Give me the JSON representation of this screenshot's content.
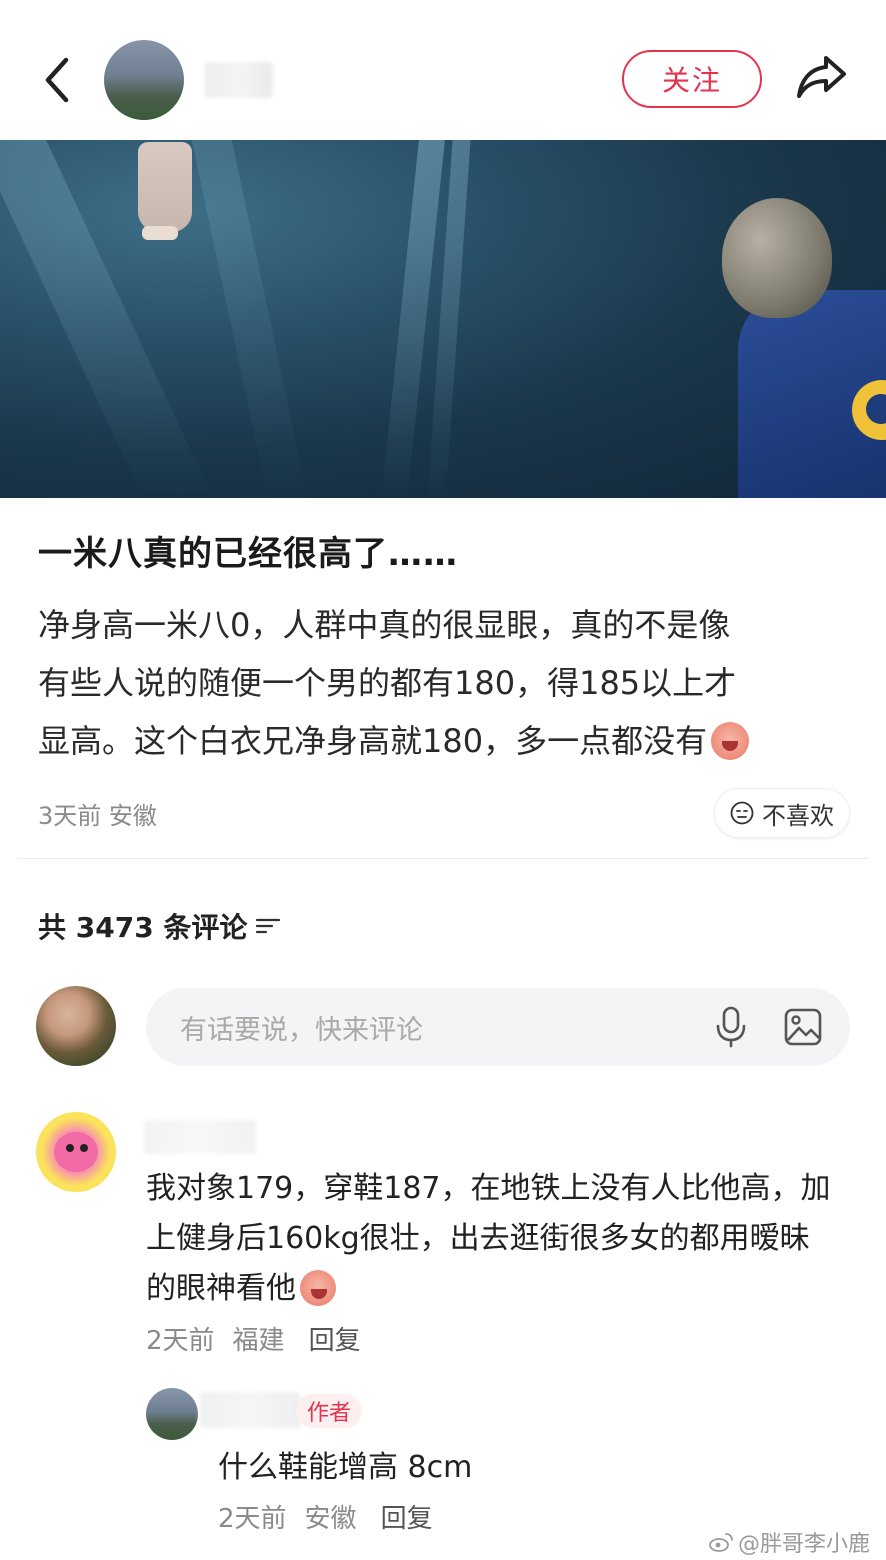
{
  "header": {
    "follow_label": "关注"
  },
  "post": {
    "title": "一米八真的已经很高了……",
    "body": [
      "净身高一米八0，人群中真的很显眼，真的不是像",
      "有些人说的随便一个男的都有180，得185以上才",
      "显高。这个白衣兄净身高就180，多一点都没有"
    ],
    "time": "3天前",
    "location": "安徽",
    "dislike_label": "不喜欢"
  },
  "comments_section": {
    "count_text": "共 3473 条评论",
    "input_placeholder": "有话要说，快来评论"
  },
  "comments": [
    {
      "text": [
        "我对象179，穿鞋187，在地铁上没有人比他高，加",
        "上健身后160kg很壮，出去逛街很多女的都用暧昧",
        "的眼神看他"
      ],
      "time": "2天前",
      "location": "福建",
      "reply_label": "回复",
      "replies": [
        {
          "badge": "作者",
          "text": "什么鞋能增高 8cm",
          "time": "2天前",
          "location": "安徽",
          "reply_label": "回复"
        }
      ]
    }
  ],
  "watermark": "@胖哥李小鹿",
  "icons": {
    "back": "back-icon",
    "share": "share-icon",
    "sort": "sort-icon",
    "mic": "mic-icon",
    "image": "image-icon",
    "dislike": "sad-face-icon",
    "watermark": "weibo-icon"
  },
  "colors": {
    "accent": "#e5334f",
    "muted_text": "#8a8a8a",
    "input_bg": "#f4f4f6"
  }
}
